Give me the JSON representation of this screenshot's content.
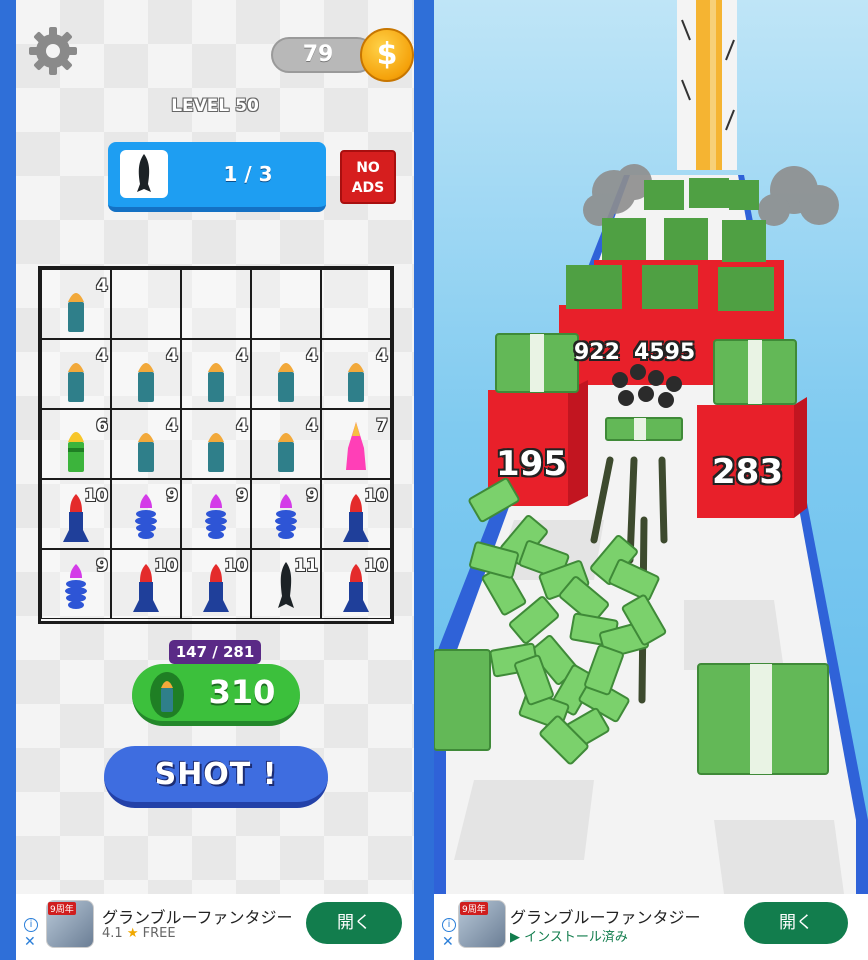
{
  "left": {
    "coins": "79",
    "coin_symbol": "$",
    "level": "LEVEL 50",
    "progress": "1 / 3",
    "no_ads": [
      "NO",
      "ADS"
    ],
    "grid": [
      [
        {
          "n": "4",
          "type": "green-bullet"
        },
        null,
        null,
        null,
        null
      ],
      [
        {
          "n": "4",
          "type": "green-bullet"
        },
        {
          "n": "4",
          "type": "green-bullet"
        },
        {
          "n": "4",
          "type": "green-bullet"
        },
        {
          "n": "4",
          "type": "green-bullet"
        },
        {
          "n": "4",
          "type": "green-bullet"
        }
      ],
      [
        {
          "n": "6",
          "type": "yellow-bullet"
        },
        {
          "n": "4",
          "type": "green-bullet"
        },
        {
          "n": "4",
          "type": "green-bullet"
        },
        {
          "n": "4",
          "type": "green-bullet"
        },
        {
          "n": "7",
          "type": "pink-rocket"
        }
      ],
      [
        {
          "n": "10",
          "type": "red-rocket"
        },
        {
          "n": "9",
          "type": "purple-spiral"
        },
        {
          "n": "9",
          "type": "purple-spiral"
        },
        {
          "n": "9",
          "type": "purple-spiral"
        },
        {
          "n": "10",
          "type": "red-rocket"
        }
      ],
      [
        {
          "n": "9",
          "type": "purple-spiral"
        },
        {
          "n": "10",
          "type": "red-rocket"
        },
        {
          "n": "10",
          "type": "red-rocket"
        },
        {
          "n": "11",
          "type": "black-missile"
        },
        {
          "n": "10",
          "type": "red-rocket"
        }
      ]
    ],
    "capacity": "147 / 281",
    "ammo": "310",
    "shot": "SHOT !"
  },
  "right": {
    "blocks": [
      "195",
      "283"
    ],
    "mid_labels": [
      "922",
      "4595"
    ]
  },
  "ads": [
    {
      "title": "グランブルーファンタジー",
      "rating": "4.1",
      "star": "★",
      "price": "FREE",
      "button": "開く",
      "thumb_badge": "9周年",
      "info": "i",
      "close": "✕"
    },
    {
      "title": "グランブルーファンタジー",
      "installed": "インストール済み",
      "button": "開く",
      "thumb_badge": "9周年",
      "info": "i",
      "close": "✕"
    }
  ],
  "colors": {
    "accent_blue": "#1e9ef2",
    "shot_blue": "#3e6de0",
    "ammo_green": "#3cc03c",
    "block_red": "#e8202a",
    "ad_green": "#127d4d"
  }
}
